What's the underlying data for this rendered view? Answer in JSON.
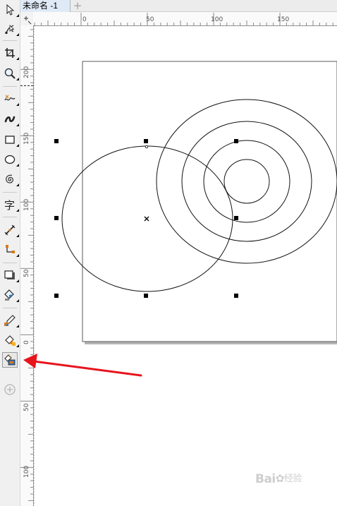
{
  "document_tab": {
    "title": "未命名 -1",
    "add_tab_symbol": "+"
  },
  "ruler": {
    "horizontal_ticks": [
      "0",
      "50",
      "100",
      "150"
    ],
    "vertical_ticks": [
      "200",
      "150",
      "100",
      "50",
      "0",
      "50",
      "100"
    ]
  },
  "toolbox": {
    "tools": [
      "pick-tool-icon",
      "shape-tool-icon",
      "crop-tool-icon",
      "zoom-tool-icon",
      "freehand-tool-icon",
      "artistic-media-tool-icon",
      "rectangle-tool-icon",
      "ellipse-tool-icon",
      "spiral-tool-icon",
      "text-tool-icon",
      "parallel-dimension-tool-icon",
      "connector-tool-icon",
      "drop-shadow-tool-icon",
      "transparency-tool-icon",
      "color-eyedropper-tool-icon",
      "interactive-fill-tool-icon",
      "smart-fill-tool-icon",
      "add-tool-icon"
    ],
    "active_tool": "smart-fill-tool-icon"
  },
  "colors": {
    "toolbox_bg": "#f0f0f0",
    "tab_active_bg": "#dfeaf6",
    "annotation_arrow": "#e8141c",
    "page_shadow": "#b3b3b3"
  },
  "watermark": {
    "brand": "Bai",
    "suffix": "经验"
  }
}
